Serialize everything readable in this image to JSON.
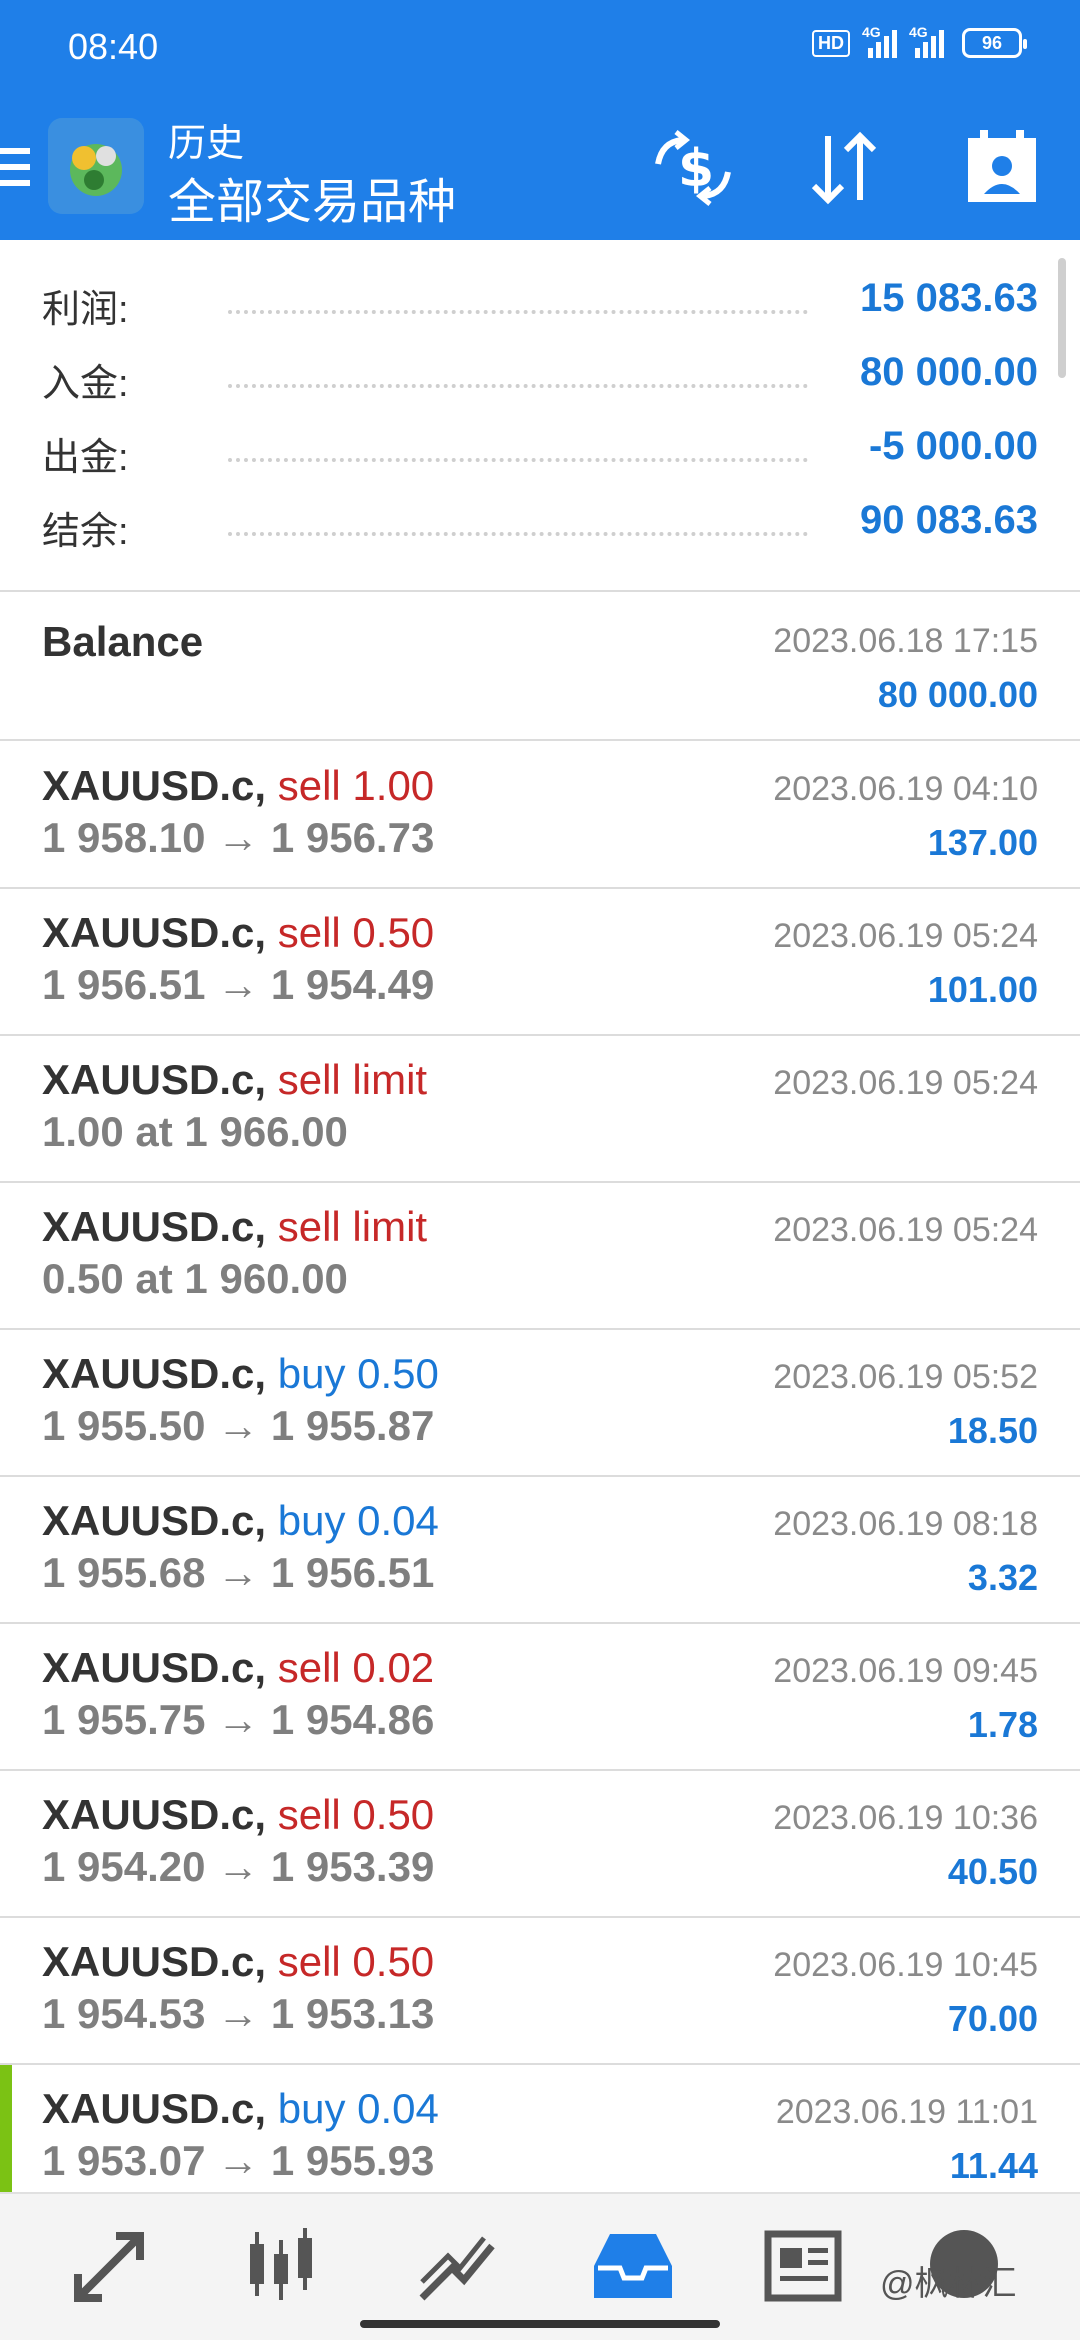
{
  "status_bar": {
    "time": "08:40",
    "network_1": "4G",
    "network_2": "4G",
    "battery": "96"
  },
  "header": {
    "title": "历史",
    "subtitle": "全部交易品种"
  },
  "summary": [
    {
      "label": "利润:",
      "value": "15 083.63"
    },
    {
      "label": "入金:",
      "value": "80 000.00"
    },
    {
      "label": "出金:",
      "value": "-5 000.00"
    },
    {
      "label": "结余:",
      "value": "90 083.63"
    }
  ],
  "balance_row": {
    "label": "Balance",
    "date": "2023.06.18 17:15",
    "amount": "80 000.00"
  },
  "deals": [
    {
      "symbol": "XAUUSD.c,",
      "action": "sell 1.00",
      "side": "sell",
      "prices": "1 958.10 → 1 956.73",
      "date": "2023.06.19 04:10",
      "profit": "137.00"
    },
    {
      "symbol": "XAUUSD.c,",
      "action": "sell 0.50",
      "side": "sell",
      "prices": "1 956.51 → 1 954.49",
      "date": "2023.06.19 05:24",
      "profit": "101.00"
    },
    {
      "symbol": "XAUUSD.c,",
      "action": "sell limit",
      "side": "sell",
      "prices": "1.00 at 1 966.00",
      "date": "2023.06.19 05:24",
      "profit": ""
    },
    {
      "symbol": "XAUUSD.c,",
      "action": "sell limit",
      "side": "sell",
      "prices": "0.50 at 1 960.00",
      "date": "2023.06.19 05:24",
      "profit": ""
    },
    {
      "symbol": "XAUUSD.c,",
      "action": "buy 0.50",
      "side": "buy",
      "prices": "1 955.50 → 1 955.87",
      "date": "2023.06.19 05:52",
      "profit": "18.50"
    },
    {
      "symbol": "XAUUSD.c,",
      "action": "buy 0.04",
      "side": "buy",
      "prices": "1 955.68 → 1 956.51",
      "date": "2023.06.19 08:18",
      "profit": "3.32"
    },
    {
      "symbol": "XAUUSD.c,",
      "action": "sell 0.02",
      "side": "sell",
      "prices": "1 955.75 → 1 954.86",
      "date": "2023.06.19 09:45",
      "profit": "1.78"
    },
    {
      "symbol": "XAUUSD.c,",
      "action": "sell 0.50",
      "side": "sell",
      "prices": "1 954.20 → 1 953.39",
      "date": "2023.06.19 10:36",
      "profit": "40.50"
    },
    {
      "symbol": "XAUUSD.c,",
      "action": "sell 0.50",
      "side": "sell",
      "prices": "1 954.53 → 1 953.13",
      "date": "2023.06.19 10:45",
      "profit": "70.00"
    },
    {
      "symbol": "XAUUSD.c,",
      "action": "buy 0.04",
      "side": "buy",
      "prices": "1 953.07 → 1 955.93",
      "date": "2023.06.19 11:01",
      "profit": "11.44"
    }
  ],
  "bottom_nav": [
    "quotes-icon",
    "chart-icon",
    "trade-icon",
    "history-icon",
    "news-icon",
    "chat-icon"
  ],
  "watermark": "@枫林汇",
  "colors": {
    "header": "#1f7fe8",
    "value_blue": "#1a78d6",
    "sell_red": "#c62828",
    "selected_bar": "#7bc214"
  }
}
